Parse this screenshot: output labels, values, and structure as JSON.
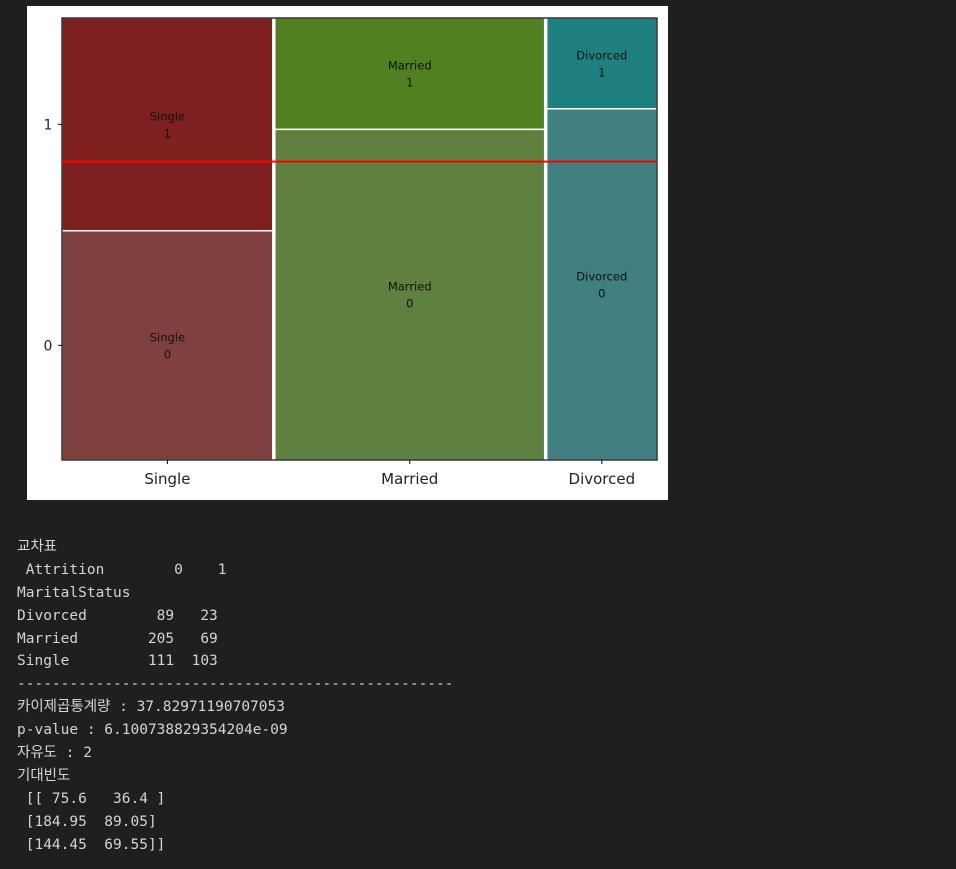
{
  "chart_data": {
    "type": "mosaic",
    "title": "",
    "xlabel": "",
    "ylabel": "",
    "categories": [
      "Single",
      "Married",
      "Divorced"
    ],
    "levels": [
      "0",
      "1"
    ],
    "counts": {
      "Single": {
        "0": 111,
        "1": 103
      },
      "Married": {
        "0": 205,
        "1": 69
      },
      "Divorced": {
        "0": 89,
        "1": 23
      }
    },
    "colors": {
      "Single": {
        "0": "#7f4040",
        "1": "#7f2020"
      },
      "Married": {
        "0": "#608040",
        "1": "#508020"
      },
      "Divorced": {
        "0": "#408080",
        "1": "#208080"
      }
    },
    "reference_line": {
      "value": 0.675,
      "color": "#ff0000",
      "meaning": "overall proportion of Attrition 0"
    },
    "yticks": [
      "0",
      "1"
    ]
  },
  "output": {
    "lines": [
      "교차표",
      " Attrition        0    1",
      "MaritalStatus",
      "Divorced        89   23",
      "Married        205   69",
      "Single         111  103",
      "--------------------------------------------------",
      "카이제곱통계량 : 37.82971190707053",
      "p-value : 6.100738829354204e-09",
      "자유도 : 2",
      "기대빈도",
      " [[ 75.6   36.4 ]",
      " [184.95  89.05]",
      " [144.45  69.55]]"
    ]
  }
}
